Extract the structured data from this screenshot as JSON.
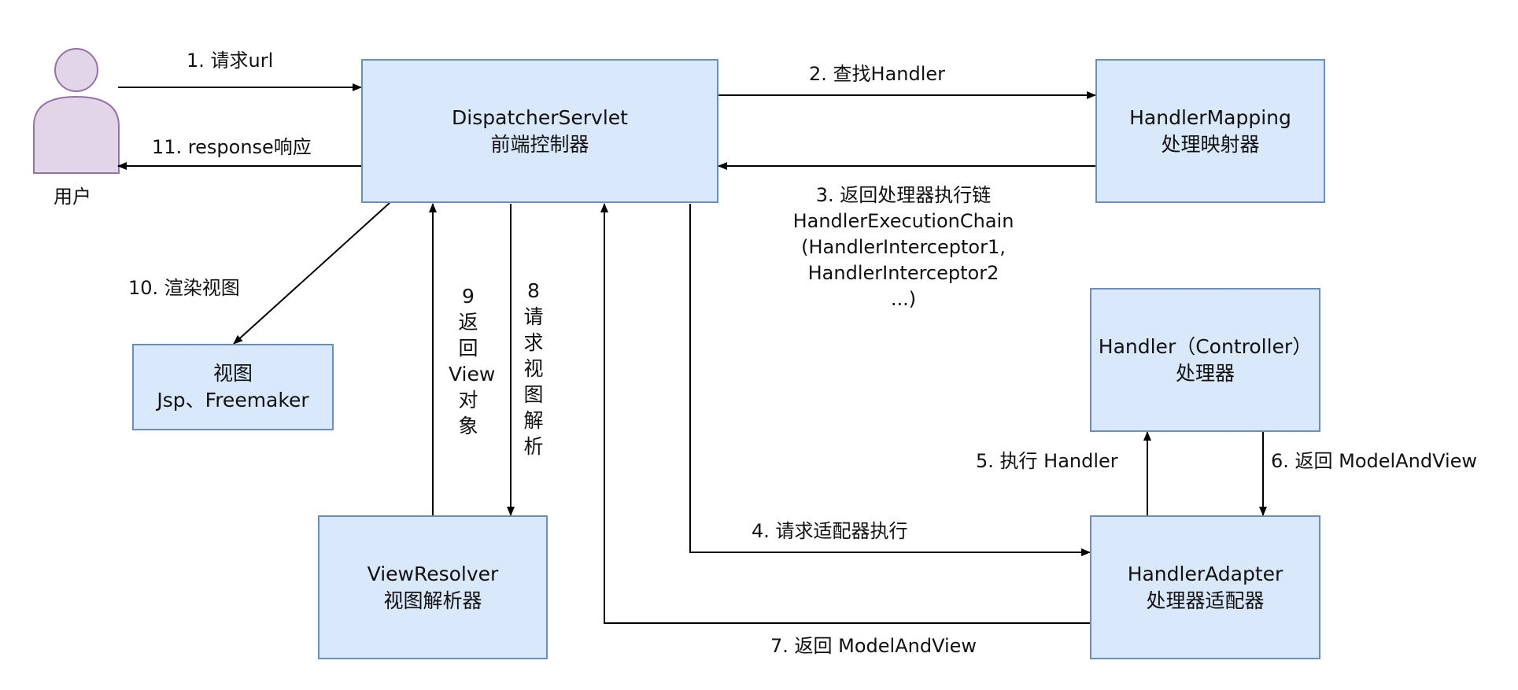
{
  "user": {
    "label": "用户",
    "fill": "#e1d5e7",
    "stroke": "#9673a6"
  },
  "nodes": {
    "dispatcher": {
      "title": "DispatcherServlet",
      "subtitle": "前端控制器"
    },
    "handler_mapping": {
      "title": "HandlerMapping",
      "subtitle": "处理映射器"
    },
    "handler": {
      "title": "Handler（Controller）",
      "subtitle": "处理器"
    },
    "handler_adapter": {
      "title": "HandlerAdapter",
      "subtitle": "处理器适配器"
    },
    "view_resolver": {
      "title": "ViewResolver",
      "subtitle": "视图解析器"
    },
    "view": {
      "title": "视图",
      "subtitle": "Jsp、Freemaker"
    }
  },
  "edges": {
    "e1": "1. 请求url",
    "e2": "2. 查找Handler",
    "e3": {
      "line1": "3. 返回处理器执行链",
      "line2": "HandlerExecutionChain",
      "line3": "(HandlerInterceptor1,",
      "line4": "HandlerInterceptor2",
      "line5": "...)"
    },
    "e4": "4. 请求适配器执行",
    "e5": "5. 执行 Handler",
    "e6": "6. 返回 ModelAndView",
    "e7": "7. 返回 ModelAndView",
    "e8": "8\n请\n求\n视\n图\n解\n析",
    "e9": "9\n返\n回\nView\n对\n象",
    "e10": "10. 渲染视图",
    "e11": "11. response响应"
  },
  "colors": {
    "box_fill": "#dae8fc",
    "box_stroke": "#6c8ebf",
    "edge": "#000000"
  }
}
